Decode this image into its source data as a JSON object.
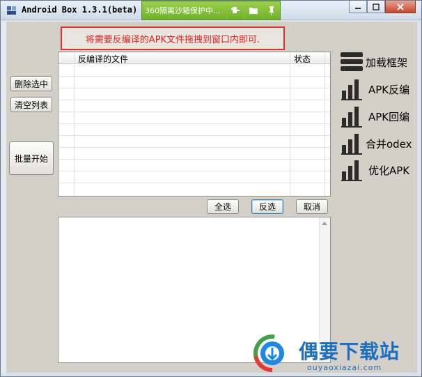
{
  "window": {
    "title": "Android Box 1.3.1(beta) -",
    "sandbox_text": "360隔离沙箱保护中...",
    "controls": {
      "minimize": "▭",
      "maximize": "□",
      "close": "✕"
    }
  },
  "hint": "将需要反编译的APK文件拖拽到窗口内即可.",
  "left_buttons": {
    "delete_selected": "删除选中",
    "clear_list": "清空列表",
    "batch_start": "批量开始"
  },
  "table": {
    "columns": [
      "反编译的文件",
      "状态"
    ],
    "rows": []
  },
  "selection_buttons": {
    "select_all": "全选",
    "invert": "反选",
    "cancel": "取消"
  },
  "actions": [
    {
      "label": "加载框架",
      "icon": "menu-icon"
    },
    {
      "label": "APK反编",
      "icon": "bars-icon"
    },
    {
      "label": "APK回编",
      "icon": "bars-icon"
    },
    {
      "label": "合并odex",
      "icon": "bars-icon"
    },
    {
      "label": "优化APK",
      "icon": "bars-icon"
    }
  ],
  "watermark": {
    "name": "偶要下载站",
    "url": "ouyaoxiazai.com"
  },
  "colors": {
    "hint_border": "#e03030",
    "hint_text": "#e02020",
    "sandbox_green": "#7bbf33",
    "watermark_blue": "#1a6fc0"
  }
}
